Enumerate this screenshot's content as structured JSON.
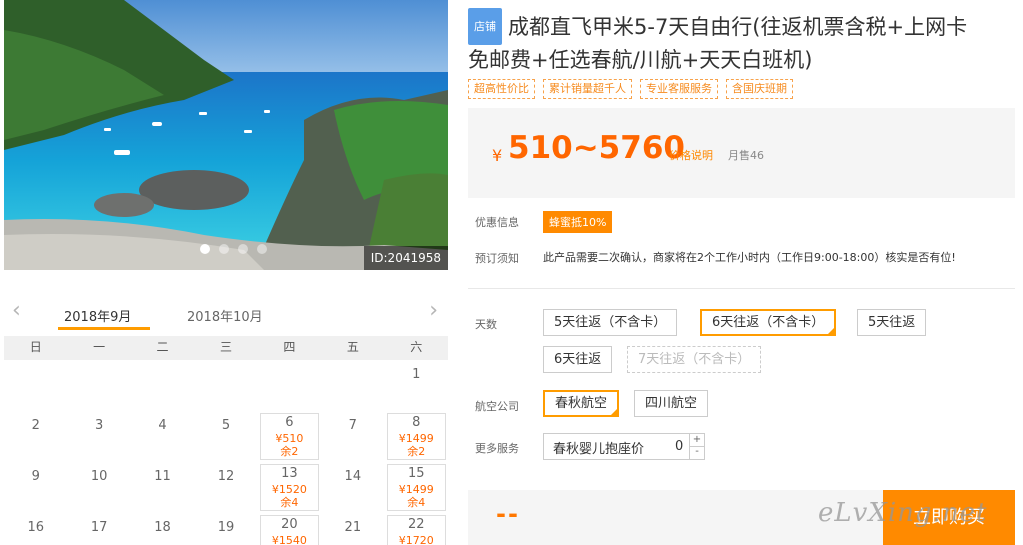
{
  "hero": {
    "photo_id": "ID:2041958",
    "dots_count": 4,
    "active_dot": 0
  },
  "product": {
    "shop_badge": "店铺",
    "title_line1": "成都直飞甲米5-7天自由行(往返机票含税+上网卡",
    "title_line2": "免邮费+任选春航/川航+天天白班机)",
    "tags": [
      "超高性价比",
      "累计销量超千人",
      "专业客服服务",
      "含国庆班期"
    ],
    "currency": "¥",
    "price_range": "510~5760",
    "price_explain": "价格说明",
    "monthly_sales": "月售46"
  },
  "info": {
    "discount_label": "优惠信息",
    "discount_badge": "蜂蜜抵10%",
    "notice_label": "预订须知",
    "notice_text": "此产品需要二次确认，商家将在2个工作小时内（工作日9:00-18:00）核实是否有位!"
  },
  "options": {
    "days_label": "天数",
    "days": [
      {
        "label": "5天往返（不含卡）",
        "state": "normal"
      },
      {
        "label": "6天往返（不含卡）",
        "state": "selected"
      },
      {
        "label": "5天往返",
        "state": "normal"
      },
      {
        "label": "6天往返",
        "state": "normal"
      },
      {
        "label": "7天往返（不含卡）",
        "state": "disabled"
      }
    ],
    "airline_label": "航空公司",
    "airlines": [
      {
        "label": "春秋航空",
        "state": "selected"
      },
      {
        "label": "四川航空",
        "state": "normal"
      }
    ],
    "more_label": "更多服务",
    "extra_service": {
      "name": "春秋婴儿抱座价",
      "quantity": "0",
      "plus": "+",
      "minus": "-"
    }
  },
  "buy": {
    "total": "--",
    "button": "立即购买",
    "watermark": "eLvXing.net"
  },
  "calendar": {
    "prev_arrow": "‹",
    "next_arrow": "›",
    "months": [
      "2018年9月",
      "2018年10月"
    ],
    "active_month": 0,
    "weekdays": [
      "日",
      "一",
      "二",
      "三",
      "四",
      "五",
      "六"
    ],
    "rows": [
      [
        {
          "day": ""
        },
        {
          "day": ""
        },
        {
          "day": ""
        },
        {
          "day": ""
        },
        {
          "day": ""
        },
        {
          "day": ""
        },
        {
          "day": "1"
        }
      ],
      [
        {
          "day": "2"
        },
        {
          "day": "3"
        },
        {
          "day": "4"
        },
        {
          "day": "5"
        },
        {
          "day": "6",
          "price": "¥510",
          "stock": "余2"
        },
        {
          "day": "7"
        },
        {
          "day": "8",
          "price": "¥1499",
          "stock": "余2"
        }
      ],
      [
        {
          "day": "9"
        },
        {
          "day": "10"
        },
        {
          "day": "11"
        },
        {
          "day": "12"
        },
        {
          "day": "13",
          "price": "¥1520",
          "stock": "余4"
        },
        {
          "day": "14"
        },
        {
          "day": "15",
          "price": "¥1499",
          "stock": "余4"
        }
      ],
      [
        {
          "day": "16"
        },
        {
          "day": "17"
        },
        {
          "day": "18"
        },
        {
          "day": "19"
        },
        {
          "day": "20",
          "price": "¥1540",
          "stock": ""
        },
        {
          "day": "21"
        },
        {
          "day": "22",
          "price": "¥1720",
          "stock": ""
        }
      ]
    ]
  },
  "colors": {
    "accent": "#ff8a00",
    "price": "#ff6600",
    "badge_blue": "#5a9ee8"
  }
}
